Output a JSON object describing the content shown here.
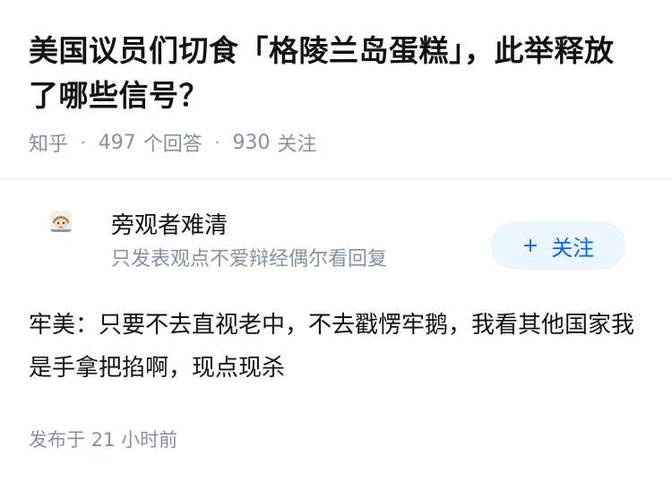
{
  "question": {
    "title": "美国议员们切食「格陵兰岛蛋糕」，此举释放了哪些信号？",
    "source": "知乎",
    "answer_count": "497",
    "answer_label": "个回答",
    "follow_count": "930",
    "follow_label": "关注"
  },
  "answer": {
    "author_name": "旁观者难清",
    "author_bio": "只发表观点不爱辩经偶尔看回复",
    "avatar_icon": "avatar-face-icon",
    "follow_button": {
      "icon": "plus-icon",
      "label": "关注",
      "color": "#0066ff",
      "bg": "#ebf5ff"
    },
    "content": "牢美：只要不去直视老中，不去戳愣牢鹅，我看其他国家我是手拿把掐啊，现点现杀",
    "published_label": "发布于",
    "published_time": "21 小时前"
  }
}
